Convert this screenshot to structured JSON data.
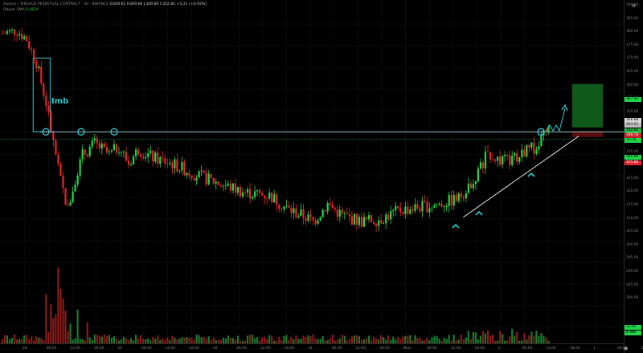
{
  "header": {
    "line1_prefix": "Aavecs / TetherUS PERPETUAL CONTRACT · 30 · BINANCE",
    "ohlc": "O349.62 H349.66 L349.80 C352.82 +3.21 (+0.92%)",
    "line2_label": "Objem  SMA",
    "line2_value": "6.482K"
  },
  "annotation": {
    "imb_label": "Imb"
  },
  "price_axis": {
    "ticks": [
      "390.00",
      "385.00",
      "380.00",
      "375.00",
      "370.00",
      "365.00",
      "360.00",
      "355.00",
      "350.00",
      "345.00",
      "340.00",
      "335.00",
      "330.00",
      "325.00",
      "320.00",
      "315.00",
      "310.00",
      "305.00",
      "300.00",
      "295.00",
      "290.00",
      "285.00",
      "280.00"
    ],
    "tags": {
      "target": "367.44",
      "level_a": "356.68",
      "level_b": "353.51",
      "last_price": "352.82",
      "last_time": "13:35",
      "stop": "348.78",
      "bid": "346.89",
      "ask": "345.86",
      "vol_a": "11.92",
      "vol_b": "6.48K"
    }
  },
  "time_axis": {
    "ticks": [
      "28",
      "06:00",
      "12:00",
      "18:00",
      "29",
      "06:00",
      "12:00",
      "18:00",
      "30",
      "06:00",
      "12:00",
      "18:00",
      "31",
      "06:00",
      "12:00",
      "18:00",
      "Main",
      "06:00",
      "12:00",
      "18:00",
      "2",
      "06:00",
      "12:00",
      "18:00",
      "1",
      "06:00",
      "12:00"
    ]
  },
  "icons": {
    "gear": "gear-icon",
    "eye": "eye-icon"
  },
  "colors": {
    "up": "#1fd84a",
    "down": "#e6262a",
    "level_line": "#9fd9de",
    "trendline": "#ffffff",
    "circle": "#2fc8d0",
    "arrow": "#2fc8d0",
    "target_box": "#0f5a1a",
    "stop_box": "#5a0c0c"
  },
  "chart_data": {
    "type": "candlestick",
    "symbol": "Aavecs / TetherUS PERPETUAL CONTRACT",
    "interval": "30",
    "exchange": "BINANCE",
    "ylim": [
      313,
      392
    ],
    "anchors": [
      {
        "t": 0,
        "p": 386
      },
      {
        "t": 6,
        "p": 387
      },
      {
        "t": 10,
        "p": 384
      },
      {
        "t": 14,
        "p": 376
      },
      {
        "t": 18,
        "p": 362
      },
      {
        "t": 21,
        "p": 348
      },
      {
        "t": 24,
        "p": 335
      },
      {
        "t": 27,
        "p": 325
      },
      {
        "t": 30,
        "p": 336
      },
      {
        "t": 33,
        "p": 344
      },
      {
        "t": 38,
        "p": 348
      },
      {
        "t": 44,
        "p": 344
      },
      {
        "t": 48,
        "p": 347
      },
      {
        "t": 52,
        "p": 341
      },
      {
        "t": 56,
        "p": 346
      },
      {
        "t": 62,
        "p": 343
      },
      {
        "t": 70,
        "p": 341
      },
      {
        "t": 80,
        "p": 337
      },
      {
        "t": 90,
        "p": 334
      },
      {
        "t": 100,
        "p": 331
      },
      {
        "t": 110,
        "p": 330
      },
      {
        "t": 118,
        "p": 325
      },
      {
        "t": 124,
        "p": 323
      },
      {
        "t": 128,
        "p": 321
      },
      {
        "t": 134,
        "p": 327
      },
      {
        "t": 140,
        "p": 323
      },
      {
        "t": 148,
        "p": 321
      },
      {
        "t": 156,
        "p": 322
      },
      {
        "t": 164,
        "p": 325
      },
      {
        "t": 172,
        "p": 326
      },
      {
        "t": 180,
        "p": 327
      },
      {
        "t": 188,
        "p": 329
      },
      {
        "t": 196,
        "p": 338
      },
      {
        "t": 200,
        "p": 345
      },
      {
        "t": 205,
        "p": 342
      },
      {
        "t": 210,
        "p": 342
      },
      {
        "t": 215,
        "p": 345
      },
      {
        "t": 220,
        "p": 347
      },
      {
        "t": 224,
        "p": 352
      }
    ],
    "levels": {
      "horizontal": 352.0,
      "trend_start": [
        170,
        322.5
      ],
      "trend_end": [
        244,
        350.5
      ]
    },
    "imbalance_zone": {
      "from_t": 12,
      "to_t": 19,
      "top": 377.5,
      "bottom": 352.0
    },
    "touch_points": [
      {
        "t": 19,
        "p": 352
      },
      {
        "t": 33,
        "p": 352
      },
      {
        "t": 47,
        "p": 352
      },
      {
        "t": 223,
        "p": 352
      }
    ],
    "volume": {
      "ylim": [
        0,
        100
      ]
    }
  }
}
